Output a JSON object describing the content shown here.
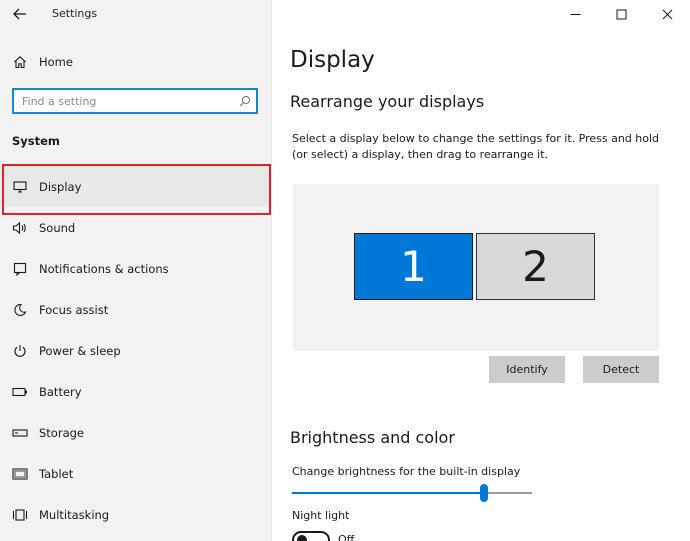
{
  "window": {
    "title": "Settings",
    "controls": {
      "minimize": "minimize",
      "maximize": "maximize",
      "close": "close"
    }
  },
  "sidebar": {
    "home_label": "Home",
    "search_placeholder": "Find a setting",
    "section_header": "System",
    "items": [
      {
        "label": "Display",
        "icon": "monitor-icon",
        "selected": true
      },
      {
        "label": "Sound",
        "icon": "speaker-icon"
      },
      {
        "label": "Notifications & actions",
        "icon": "notification-icon"
      },
      {
        "label": "Focus assist",
        "icon": "moon-icon"
      },
      {
        "label": "Power & sleep",
        "icon": "power-icon"
      },
      {
        "label": "Battery",
        "icon": "battery-icon"
      },
      {
        "label": "Storage",
        "icon": "storage-icon"
      },
      {
        "label": "Tablet",
        "icon": "tablet-icon"
      },
      {
        "label": "Multitasking",
        "icon": "multitasking-icon"
      }
    ]
  },
  "main": {
    "page_title": "Display",
    "rearrange_title": "Rearrange your displays",
    "rearrange_desc": "Select a display below to change the settings for it. Press and hold (or select) a display, then drag to rearrange it.",
    "monitors": [
      {
        "label": "1",
        "selected": true
      },
      {
        "label": "2",
        "selected": false
      }
    ],
    "identify_label": "Identify",
    "detect_label": "Detect",
    "brightness_title": "Brightness and color",
    "brightness_label": "Change brightness for the built-in display",
    "brightness_value": 80,
    "night_light_label": "Night light",
    "night_light_state": "Off"
  },
  "colors": {
    "accent": "#0078d7",
    "highlight": "#e0202a",
    "sidebar_bg": "#f2f2f2"
  }
}
